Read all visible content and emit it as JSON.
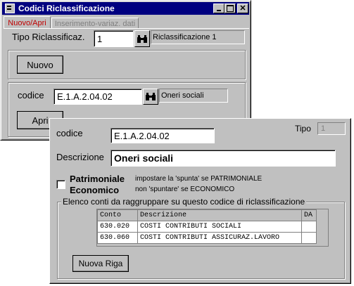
{
  "back_window": {
    "title": "Codici Riclassificazione",
    "tabs": [
      "Nuovo/Apri",
      "Inserimento-variaz. dati"
    ],
    "tipo_label": "Tipo Riclassificaz.",
    "tipo_value": "1",
    "tipo_desc": "Riclassificazione 1",
    "nuovo_label": "Nuovo",
    "codice_label": "codice",
    "codice_value": "E.1.A.2.04.02",
    "codice_desc": "Oneri sociali",
    "apri_label": "Apri"
  },
  "front_window": {
    "codice_label": "codice",
    "codice_value": "E.1.A.2.04.02",
    "tipo_label": "Tipo",
    "tipo_value": "1",
    "descrizione_label": "Descrizione",
    "descrizione_value": "Oneri sociali",
    "patrimoniale_label": "Patrimoniale",
    "economico_label": "Economico",
    "hint_patrimoniale": "impostare la 'spunta' se PATRIMONIALE",
    "hint_economico": "non 'spuntare' se ECONOMICO",
    "group_title": "Elenco conti da raggruppare su questo codice di riclassificazione",
    "table": {
      "headers": [
        "Conto",
        "Descrizione",
        "DA"
      ],
      "rows": [
        [
          "630.020",
          "COSTI CONTRIBUTI SOCIALI",
          ""
        ],
        [
          "630.060",
          "COSTI CONTRIBUTI ASSICURAZ.LAVORO",
          ""
        ]
      ]
    },
    "nuova_riga_label": "Nuova Riga"
  },
  "icons": {
    "window_icon": "app-icon",
    "search": "binoculars-icon"
  }
}
